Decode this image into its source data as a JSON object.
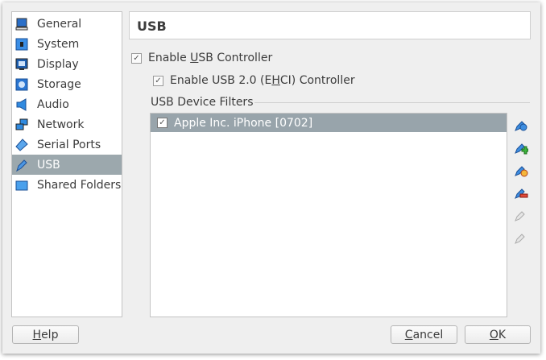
{
  "sidebar": {
    "items": [
      {
        "label": "General",
        "icon": "general-icon"
      },
      {
        "label": "System",
        "icon": "system-icon"
      },
      {
        "label": "Display",
        "icon": "display-icon"
      },
      {
        "label": "Storage",
        "icon": "storage-icon"
      },
      {
        "label": "Audio",
        "icon": "audio-icon"
      },
      {
        "label": "Network",
        "icon": "network-icon"
      },
      {
        "label": "Serial Ports",
        "icon": "serial-ports-icon"
      },
      {
        "label": "USB",
        "icon": "usb-icon",
        "selected": true
      },
      {
        "label": "Shared Folders",
        "icon": "shared-folders-icon"
      }
    ]
  },
  "header": {
    "title": "USB"
  },
  "usb_controller": {
    "pre": "Enable ",
    "key": "U",
    "post": "SB Controller",
    "checked": true
  },
  "usb2": {
    "pre": "Enable USB 2.0 (E",
    "key": "H",
    "post": "CI) Controller",
    "checked": true
  },
  "filters": {
    "title": "USB Device Filters",
    "items": [
      {
        "label": "Apple Inc. iPhone [0702]",
        "checked": true
      }
    ]
  },
  "toolbar": [
    "add-empty-filter-icon",
    "add-filter-from-device-icon",
    "edit-filter-icon",
    "remove-filter-icon",
    "move-filter-up-icon",
    "move-filter-down-icon"
  ],
  "buttons": {
    "help": {
      "key": "H",
      "post": "elp"
    },
    "cancel": {
      "key": "C",
      "post": "ancel"
    },
    "ok": {
      "key": "O",
      "post": "K"
    }
  },
  "colors": {
    "selection": "#9ca8ad",
    "accent": "#2f7fd8"
  }
}
